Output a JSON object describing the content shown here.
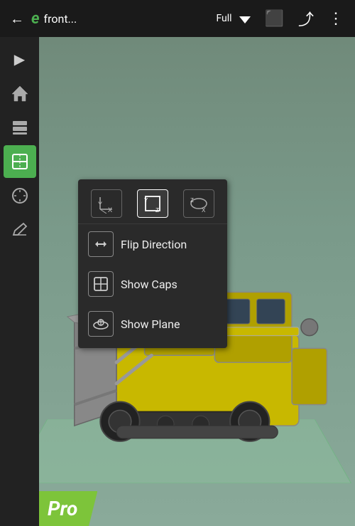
{
  "topbar": {
    "back_label": "←",
    "logo": "e",
    "title": "front...",
    "full_label": "Full",
    "icons": [
      "⬛",
      "⤴",
      "⋮"
    ]
  },
  "sidebar": {
    "buttons": [
      {
        "name": "play",
        "icon": "▶",
        "active": false
      },
      {
        "name": "home",
        "icon": "⌂",
        "active": false
      },
      {
        "name": "layers",
        "icon": "⬚",
        "active": false
      },
      {
        "name": "section",
        "icon": "⬛",
        "active": true
      },
      {
        "name": "measure",
        "icon": "⊞",
        "active": false
      },
      {
        "name": "edit",
        "icon": "✏",
        "active": false
      }
    ]
  },
  "dropdown": {
    "top_icons": [
      {
        "name": "xy-axis",
        "icon": "⊹",
        "selected": false
      },
      {
        "name": "yz-axis",
        "icon": "⊞",
        "selected": true
      },
      {
        "name": "xz-axis",
        "icon": "⊛",
        "selected": false
      }
    ],
    "items": [
      {
        "name": "flip-direction",
        "icon": "↺",
        "label": "Flip Direction"
      },
      {
        "name": "show-caps",
        "icon": "⬡",
        "label": "Show Caps"
      },
      {
        "name": "show-plane",
        "icon": "◈",
        "label": "Show Plane"
      }
    ]
  },
  "pro_badge": {
    "label": "Pro"
  }
}
